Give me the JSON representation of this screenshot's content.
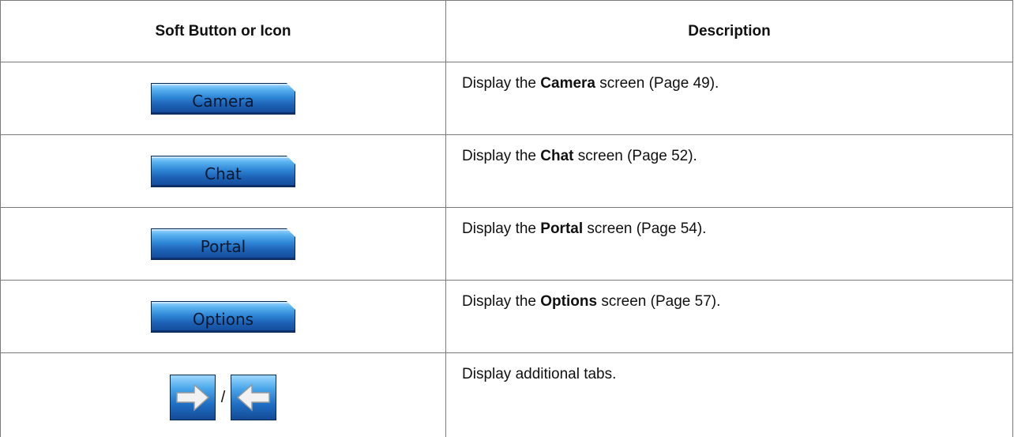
{
  "table": {
    "header": {
      "col1": "Soft Button or Icon",
      "col2": "Description"
    },
    "rows": [
      {
        "button_label": "Camera",
        "desc_prefix": "Display the ",
        "desc_bold": "Camera",
        "desc_suffix": " screen (Page 49)."
      },
      {
        "button_label": "Chat",
        "desc_prefix": "Display the ",
        "desc_bold": "Chat",
        "desc_suffix": " screen (Page 52)."
      },
      {
        "button_label": "Portal",
        "desc_prefix": "Display the ",
        "desc_bold": "Portal",
        "desc_suffix": " screen (Page 54)."
      },
      {
        "button_label": "Options",
        "desc_prefix": "Display the ",
        "desc_bold": "Options",
        "desc_suffix": " screen (Page 57)."
      },
      {
        "separator": "/",
        "icons": [
          "arrow-right-icon",
          "arrow-left-icon"
        ],
        "description": "Display additional tabs."
      }
    ]
  },
  "colors": {
    "button_gradient_top": "#9fd8ff",
    "button_gradient_bottom": "#144a96",
    "border": "#7a7a7a"
  }
}
